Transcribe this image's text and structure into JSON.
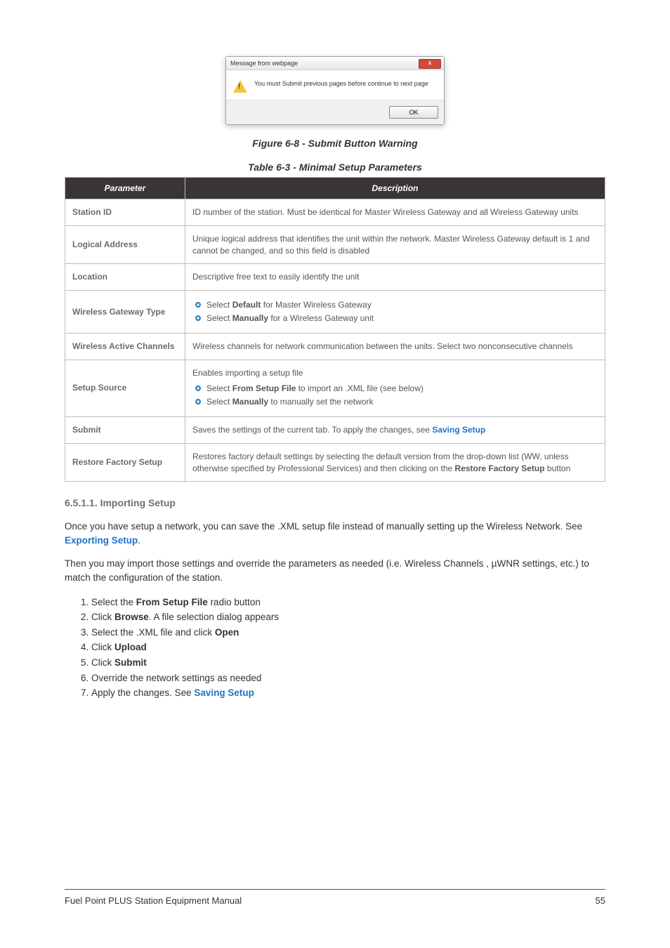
{
  "dialog": {
    "title": "Message from webpage",
    "close_glyph": "x",
    "message": "You must Submit previous pages before continue to next page",
    "ok_label": "OK"
  },
  "figure_caption": "Figure 6-8 - Submit Button Warning",
  "table_caption": "Table 6-3 - Minimal Setup Parameters",
  "table": {
    "headers": {
      "param": "Parameter",
      "desc": "Description"
    },
    "rows": {
      "station_id": {
        "param": "Station ID",
        "desc": "ID number of the station. Must be identical for Master Wireless Gateway and all Wireless Gateway units"
      },
      "logical_address": {
        "param": "Logical Address",
        "desc": "Unique logical address that identifies the unit within the network. Master Wireless Gateway default is 1 and cannot be changed, and so this field is disabled"
      },
      "location": {
        "param": "Location",
        "desc": "Descriptive free text to easily identify the unit"
      },
      "wgw_type": {
        "param": "Wireless Gateway Type",
        "b1_pre": "Select ",
        "b1_bold": "Default",
        "b1_post": " for Master Wireless Gateway",
        "b2_pre": "Select ",
        "b2_bold": "Manually",
        "b2_post": " for a Wireless Gateway unit"
      },
      "wac": {
        "param": "Wireless Active Channels",
        "desc": "Wireless channels for network communication between the units. Select two nonconsecutive channels"
      },
      "setup_source": {
        "param": "Setup Source",
        "lead": "Enables importing a setup file",
        "b1_pre": "Select ",
        "b1_bold": "From Setup File",
        "b1_post": " to import an .XML file (see below)",
        "b2_pre": "Select ",
        "b2_bold": "Manually",
        "b2_post": " to manually set the network"
      },
      "submit": {
        "param": "Submit",
        "pre": "Saves the settings of the current tab. To apply the changes, see ",
        "link": "Saving Setup"
      },
      "rfs": {
        "param": "Restore Factory Setup",
        "pre": "Restores factory default settings by selecting the default version from the drop-down list (WW, unless otherwise specified by Professional Services) and then clicking on the ",
        "bold": "Restore Factory Setup",
        "post": " button"
      }
    }
  },
  "section_heading": "6.5.1.1. Importing Setup",
  "para1": {
    "pre": "Once you have setup a network, you can save the .XML setup file instead of manually setting up the Wireless Network. See ",
    "link": "Exporting Setup",
    "post": "."
  },
  "para2": "Then you may import those settings and override the parameters as needed (i.e. Wireless Channels , µWNR settings, etc.) to match the configuration of the station.",
  "steps": {
    "s1_pre": "Select the ",
    "s1_bold": "From Setup File",
    "s1_post": " radio button",
    "s2_pre": "Click ",
    "s2_bold": "Browse",
    "s2_post": ". A file selection dialog appears",
    "s3_pre": "Select the .XML file and click ",
    "s3_bold": "Open",
    "s4_pre": "Click ",
    "s4_bold": "Upload",
    "s5_pre": "Click ",
    "s5_bold": "Submit",
    "s6": "Override the network settings as needed",
    "s7_pre": "Apply the changes. See ",
    "s7_link": "Saving Setup"
  },
  "footer": {
    "left": "Fuel Point PLUS Station Equipment Manual",
    "right": "55"
  }
}
